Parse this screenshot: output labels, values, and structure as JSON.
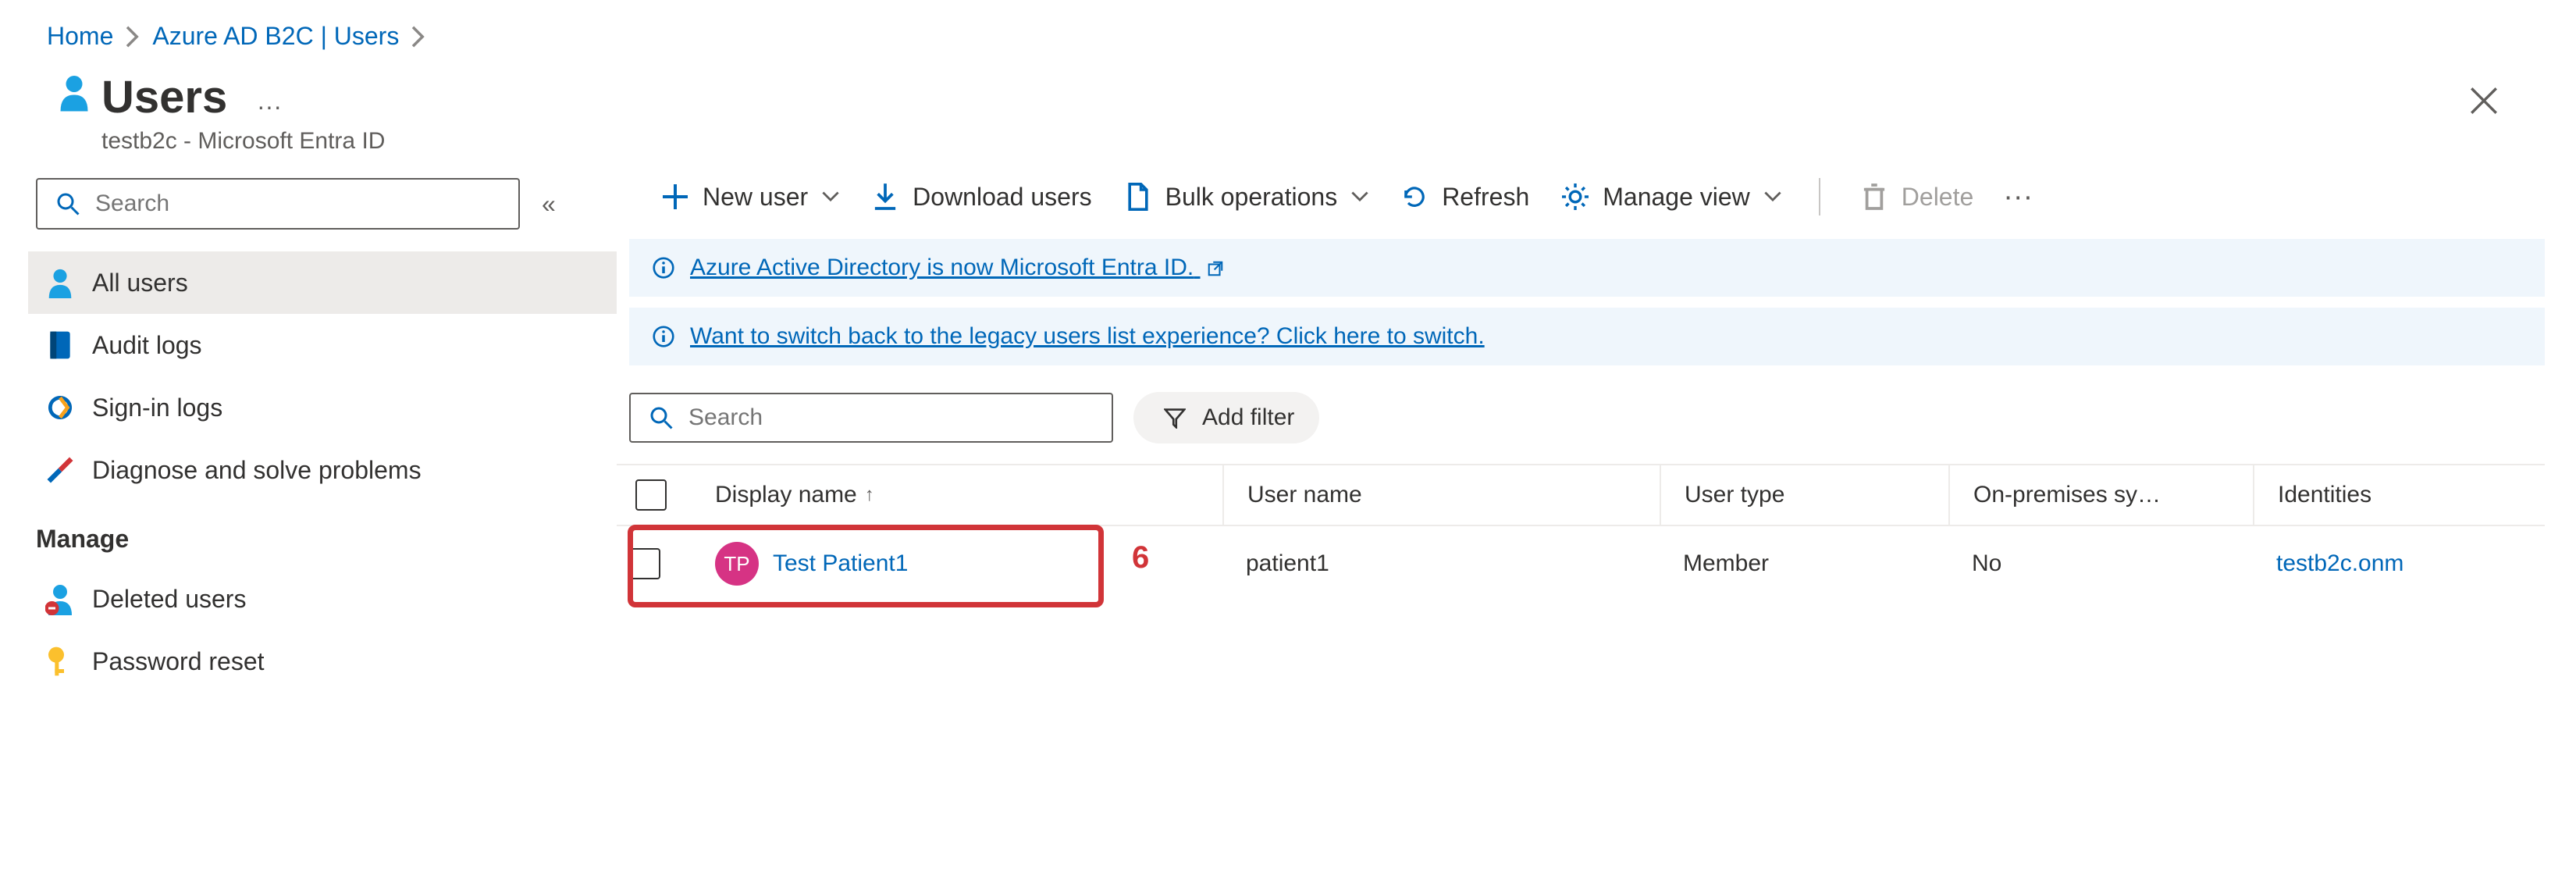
{
  "breadcrumb": [
    {
      "label": "Home"
    },
    {
      "label": "Azure AD B2C | Users"
    }
  ],
  "header": {
    "title": "Users",
    "subtitle": "testb2c - Microsoft Entra ID"
  },
  "sidebar": {
    "search_placeholder": "Search",
    "items": [
      {
        "label": "All users",
        "icon": "user-icon",
        "active": true
      },
      {
        "label": "Audit logs",
        "icon": "book-icon"
      },
      {
        "label": "Sign-in logs",
        "icon": "signin-icon"
      },
      {
        "label": "Diagnose and solve problems",
        "icon": "wrench-icon"
      }
    ],
    "section_label": "Manage",
    "manage_items": [
      {
        "label": "Deleted users",
        "icon": "deleted-user-icon"
      },
      {
        "label": "Password reset",
        "icon": "key-icon"
      }
    ]
  },
  "toolbar": {
    "new_user": "New user",
    "download_users": "Download users",
    "bulk_operations": "Bulk operations",
    "refresh": "Refresh",
    "manage_view": "Manage view",
    "delete": "Delete"
  },
  "banners": {
    "msg1": "Azure Active Directory is now Microsoft Entra ID.",
    "msg2": "Want to switch back to the legacy users list experience? Click here to switch."
  },
  "filters": {
    "search_placeholder": "Search",
    "add_filter": "Add filter"
  },
  "table": {
    "columns": {
      "display_name": "Display name",
      "user_name": "User name",
      "user_type": "User type",
      "on_prem": "On-premises sy…",
      "identities": "Identities"
    },
    "rows": [
      {
        "avatar_initials": "TP",
        "display_name": "Test Patient1",
        "user_name": "patient1",
        "user_type": "Member",
        "on_prem": "No",
        "identities": "testb2c.onm"
      }
    ]
  },
  "annotation": {
    "number": "6"
  }
}
